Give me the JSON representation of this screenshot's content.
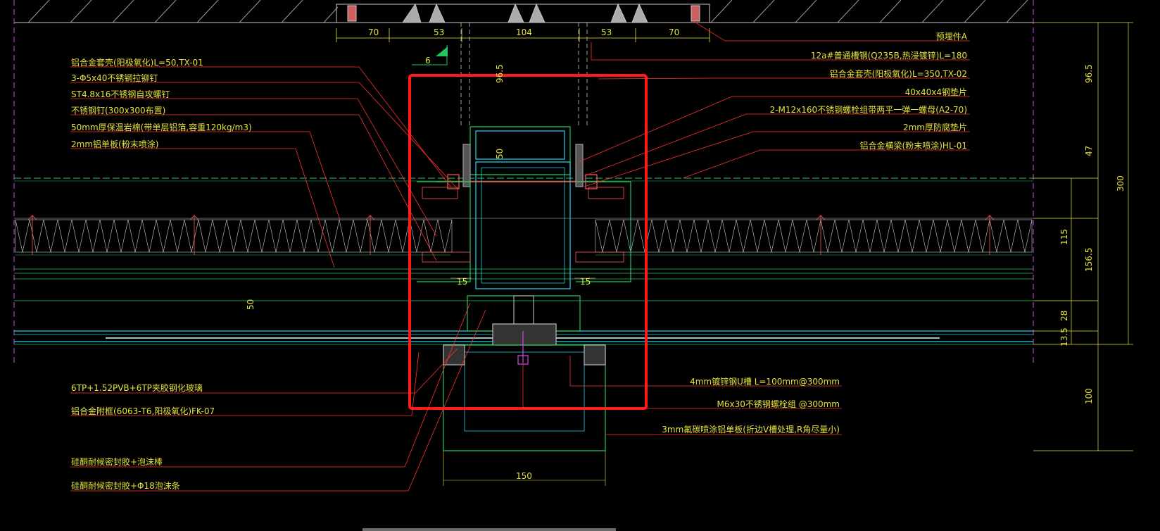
{
  "labels_left_top": [
    "铝合金套壳(阳极氧化)L=50,TX-01",
    "3-Φ5x40不锈钢拉铆钉",
    "ST4.8x16不锈钢自攻螺钉",
    "不锈钢钉(300x300布置)",
    "50mm厚保温岩棉(带单层铝箔,容重120kg/m3)",
    "2mm铝单板(粉末喷涂)"
  ],
  "labels_right_top": [
    "预埋件A",
    "12a#普通槽钢(Q235B,热浸镀锌)L=180",
    "铝合金套壳(阳极氧化)L=350,TX-02",
    "40x40x4钢垫片",
    "2-M12x160不锈钢螺栓组带两平一弹一螺母(A2-70)",
    "2mm厚防腐垫片",
    "铝合金横梁(粉末喷涂)HL-01"
  ],
  "labels_left_bottom": [
    "6TP+1.52PVB+6TP夹胶钢化玻璃",
    "铝合金附框(6063-T6,阳极氧化)FK-07",
    "硅酮耐候密封胶+泡沫棒",
    "硅酮耐候密封胶+Φ18泡沫条"
  ],
  "labels_right_bottom": [
    "4mm镀锌钢U槽 L=100mm@300mm",
    "M6x30不锈钢螺栓组 @300mm",
    "3mm氟碳喷涂铝单板(折边V槽处理,R角尽量小)"
  ],
  "dims_top": [
    "70",
    "53",
    "104",
    "53",
    "70"
  ],
  "dim_slope": "6",
  "dims_vertical_inner": [
    "96.5",
    "50",
    "50"
  ],
  "dims_horizontal_inner": [
    "15",
    "15",
    "150"
  ],
  "dims_right": [
    "96.5",
    "47",
    "300",
    "115",
    "156.5",
    "28",
    "13.5",
    "100"
  ],
  "colors": {
    "background": "#000000",
    "text": "#e8e23a",
    "leader": "#ff3030",
    "frame": "#22c55e",
    "cyan": "#22d3ee",
    "highlight": "#ff1a1a",
    "insulation": "#c8c8c8"
  }
}
